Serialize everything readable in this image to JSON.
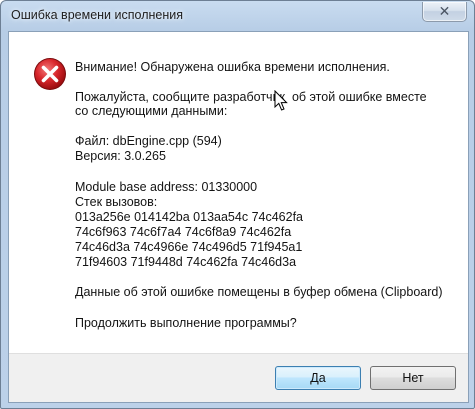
{
  "window": {
    "title": "Ошибка времени исполнения",
    "close_glyph": "✕"
  },
  "dialog": {
    "icon": "error-icon",
    "accent_color": "#d8262b",
    "lines": [
      "Внимание! Обнаружена ошибка времени исполнения.",
      "Пожалуйста, сообщите разработчик  об этой ошибке вместе",
      "со следующими данными:",
      "Файл: dbEngine.cpp (594)",
      "Версия: 3.0.265",
      "Module base address: 01330000",
      "Стек вызовов:",
      "013a256e 014142ba 013aa54c 74c462fa",
      "74c6f963 74c6f7a4 74c6f8a9 74c462fa",
      "74c46d3a 74c4966e 74c496d5 71f945a1",
      "71f94603 71f9448d 74c462fa 74c46d3a",
      "Данные об этой ошибке помещены в буфер обмена (Clipboard)",
      "Продолжить выполнение программы?"
    ]
  },
  "buttons": {
    "yes_label": "Да",
    "no_label": "Нет"
  }
}
